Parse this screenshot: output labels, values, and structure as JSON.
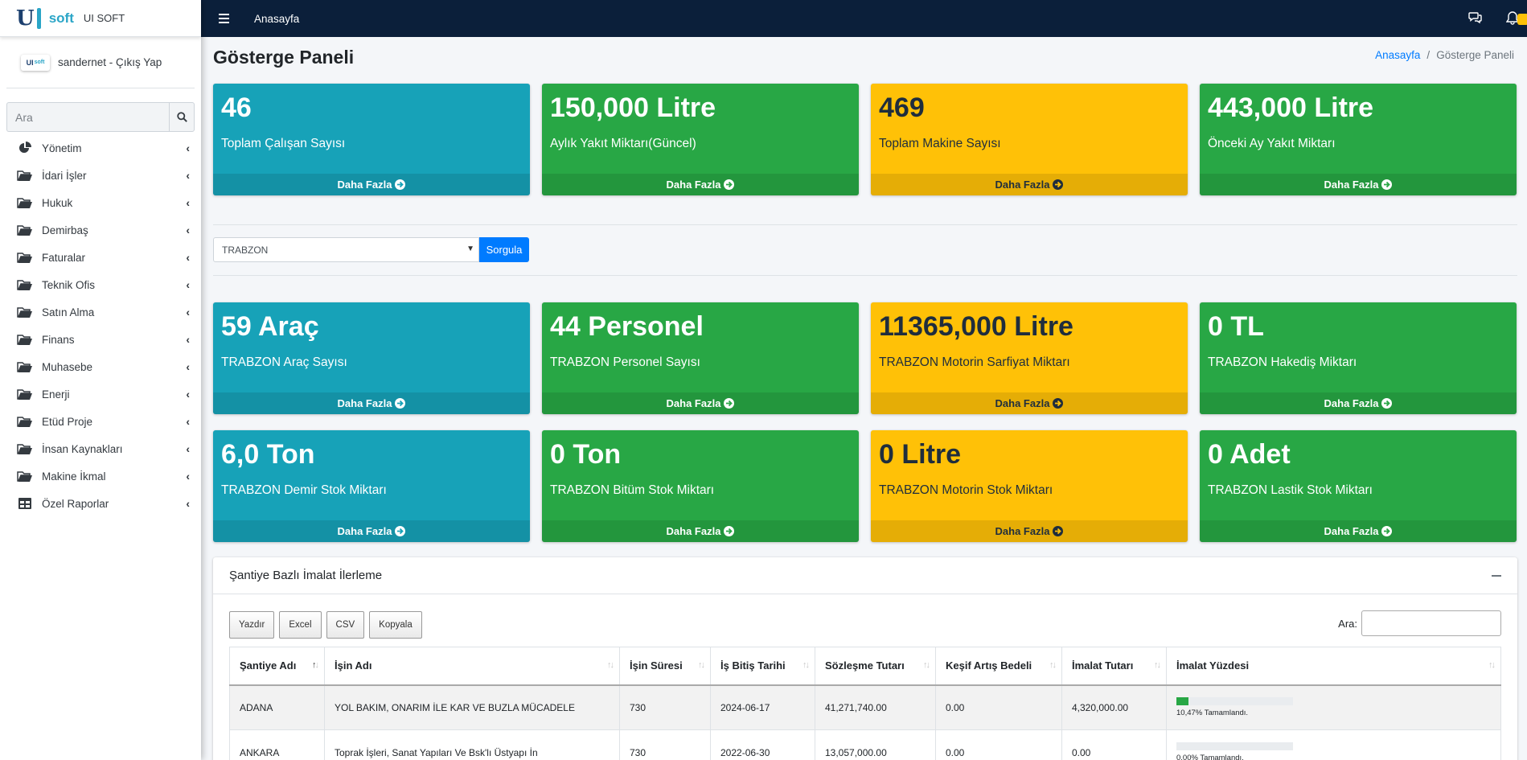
{
  "brand": {
    "logo_text": "soft",
    "name": "UI SOFT"
  },
  "user": {
    "logo_text": "UI",
    "name": "sandernet - Çıkış Yap"
  },
  "search": {
    "placeholder": "Ara"
  },
  "sidebar": {
    "items": [
      {
        "label": "Yönetim",
        "icon": "chart-pie-icon"
      },
      {
        "label": "İdari İşler",
        "icon": "folder-open-icon"
      },
      {
        "label": "Hukuk",
        "icon": "folder-open-icon"
      },
      {
        "label": "Demirbaş",
        "icon": "folder-open-icon"
      },
      {
        "label": "Faturalar",
        "icon": "folder-open-icon"
      },
      {
        "label": "Teknik Ofis",
        "icon": "folder-open-icon"
      },
      {
        "label": "Satın Alma",
        "icon": "folder-open-icon"
      },
      {
        "label": "Finans",
        "icon": "folder-open-icon"
      },
      {
        "label": "Muhasebe",
        "icon": "folder-open-icon"
      },
      {
        "label": "Enerji",
        "icon": "folder-open-icon"
      },
      {
        "label": "Etüd Proje",
        "icon": "folder-open-icon"
      },
      {
        "label": "İnsan Kaynakları",
        "icon": "folder-open-icon"
      },
      {
        "label": "Makine İkmal",
        "icon": "folder-open-icon"
      },
      {
        "label": "Özel Raporlar",
        "icon": "table-icon"
      }
    ],
    "caret": "‹"
  },
  "topbar": {
    "home_label": "Anasayfa"
  },
  "page": {
    "title": "Gösterge Paneli",
    "breadcrumb": {
      "home": "Anasayfa",
      "sep": "/",
      "current": "Gösterge Paneli"
    }
  },
  "more_label": "Daha Fazla",
  "colors": {
    "info": "#17a2b8",
    "success": "#28a745",
    "warning": "#ffc107",
    "primary": "#007bff",
    "topbar": "#0b1f3a"
  },
  "boxes_top": [
    {
      "value": "46",
      "label": "Toplam Çalışan Sayısı",
      "color": "info"
    },
    {
      "value": "150,000 Litre",
      "label": "Aylık Yakıt Miktarı(Güncel)",
      "color": "success"
    },
    {
      "value": "469",
      "label": "Toplam Makine Sayısı",
      "color": "warning"
    },
    {
      "value": "443,000 Litre",
      "label": "Önceki Ay Yakıt Miktarı",
      "color": "success"
    }
  ],
  "filter": {
    "selected": "TRABZON",
    "button": "Sorgula"
  },
  "boxes_mid": [
    {
      "value": "59 Araç",
      "label": "TRABZON Araç Sayısı",
      "color": "info"
    },
    {
      "value": "44 Personel",
      "label": "TRABZON Personel Sayısı",
      "color": "success"
    },
    {
      "value": "11365,000 Litre",
      "label": "TRABZON Motorin Sarfiyat Miktarı",
      "color": "warning"
    },
    {
      "value": "0 TL",
      "label": "TRABZON Hakediş Miktarı",
      "color": "success"
    }
  ],
  "boxes_bot": [
    {
      "value": "6,0 Ton",
      "label": "TRABZON Demir Stok Miktarı",
      "color": "info"
    },
    {
      "value": "0 Ton",
      "label": "TRABZON Bitüm Stok Miktarı",
      "color": "success"
    },
    {
      "value": "0 Litre",
      "label": "TRABZON Motorin Stok Miktarı",
      "color": "warning"
    },
    {
      "value": "0 Adet",
      "label": "TRABZON Lastik Stok Miktarı",
      "color": "success"
    }
  ],
  "card": {
    "title": "Şantiye Bazlı İmalat İlerleme",
    "tools": [
      "Yazdır",
      "Excel",
      "CSV",
      "Kopyala"
    ],
    "search_label": "Ara:",
    "columns": [
      "Şantiye Adı",
      "İşin Adı",
      "İşin Süresi",
      "İş Bitiş Tarihi",
      "Sözleşme Tutarı",
      "Keşif Artış Bedeli",
      "İmalat Tutarı",
      "İmalat Yüzdesi"
    ],
    "rows": [
      {
        "cells": [
          "ADANA",
          "YOL BAKIM, ONARIM İLE KAR VE BUZLA MÜCADELE",
          "730",
          "2024-06-17",
          "41,271,740.00",
          "0.00",
          "4,320,000.00"
        ],
        "progress": 10.47,
        "progress_text": "10,47% Tamamlandı."
      },
      {
        "cells": [
          "ANKARA",
          "Toprak İşleri, Sanat Yapıları Ve Bsk'lı Üstyapı İn",
          "730",
          "2022-06-30",
          "13,057,000.00",
          "0.00",
          "0.00"
        ],
        "progress": 0,
        "progress_text": "0,00% Tamamlandı."
      }
    ]
  }
}
